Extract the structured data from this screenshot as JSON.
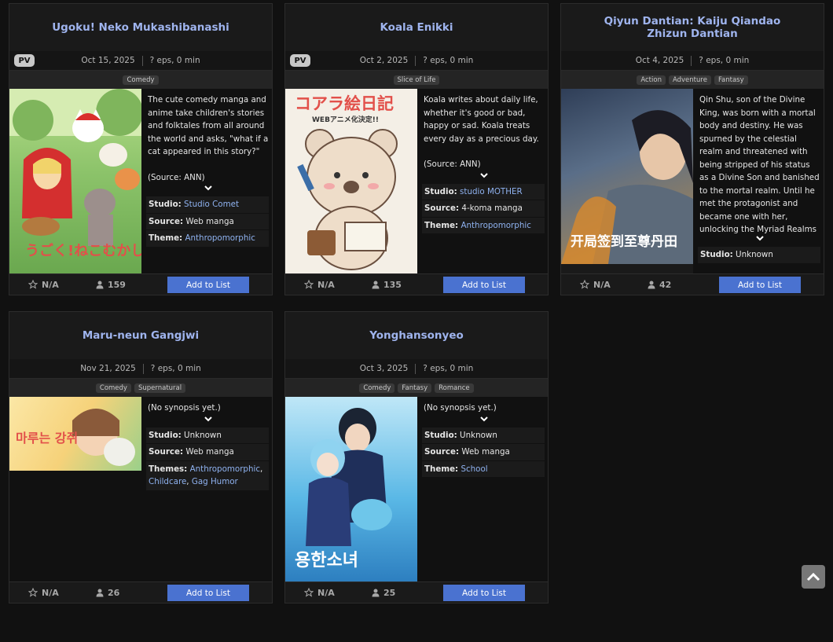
{
  "cards": [
    {
      "title": "Ugoku! Neko Mukashibanashi",
      "pv": "PV",
      "date": "Oct 15, 2025",
      "eps": "? eps, 0 min",
      "genres": [
        "Comedy"
      ],
      "synopsis": "The cute comedy manga and anime take children's stories and folktales from all around the world and asks, \"what if a cat appeared in this story?\"",
      "source_note": "(Source: ANN)",
      "studio_label": "Studio:",
      "studio": "Studio Comet",
      "source_label": "Source:",
      "source": "Web manga",
      "theme_label": "Theme:",
      "themes": "Anthropomorphic",
      "score": "N/A",
      "members": "159",
      "add_label": "Add to List",
      "cover_text": "うごく!ねこむかしばなし",
      "cover_color": "#8cc36a"
    },
    {
      "title": "Koala Enikki",
      "pv": "PV",
      "date": "Oct 2, 2025",
      "eps": "? eps, 0 min",
      "genres": [
        "Slice of Life"
      ],
      "synopsis": "Koala writes about daily life, whether it's good or bad, happy or sad. Koala treats every day as a precious day.",
      "source_note": "(Source: ANN)",
      "studio_label": "Studio:",
      "studio": "studio MOTHER",
      "source_label": "Source:",
      "source": "4-koma manga",
      "theme_label": "Theme:",
      "themes": "Anthropomorphic",
      "score": "N/A",
      "members": "135",
      "add_label": "Add to List",
      "cover_text": "コアラ絵日記",
      "cover_sub": "WEBアニメ化決定!!",
      "cover_color": "#f4efe6"
    },
    {
      "title": "Qiyun Dantian: Kaiju Qiandao Zhizun Dantian",
      "date": "Oct 4, 2025",
      "eps": "? eps, 0 min",
      "genres": [
        "Action",
        "Adventure",
        "Fantasy"
      ],
      "synopsis": "Qin Shu, son of the Divine King, was born with a mortal body and destiny. He was spurned by the celestial realm and threatened with being stripped of his status as a Divine Son and banished to the mortal realm. Until he met the protagonist and became one with her, unlocking the Myriad Realms sign-in system and",
      "studio_label": "Studio:",
      "studio": "Unknown",
      "score": "N/A",
      "members": "42",
      "add_label": "Add to List",
      "cover_text": "开局签到至尊丹田",
      "cover_color": "#5a6e88"
    },
    {
      "title": "Maru-neun Gangjwi",
      "date": "Nov 21, 2025",
      "eps": "? eps, 0 min",
      "genres": [
        "Comedy",
        "Supernatural"
      ],
      "synopsis": "(No synopsis yet.)",
      "studio_label": "Studio:",
      "studio": "Unknown",
      "source_label": "Source:",
      "source": "Web manga",
      "theme_label": "Themes:",
      "themes_list": [
        "Anthropomorphic",
        "Childcare",
        "Gag Humor"
      ],
      "score": "N/A",
      "members": "26",
      "add_label": "Add to List",
      "cover_text": "마루는 강쥐",
      "cover_color": "#f6d27a"
    },
    {
      "title": "Yonghansonyeo",
      "date": "Oct 3, 2025",
      "eps": "? eps, 0 min",
      "genres": [
        "Comedy",
        "Fantasy",
        "Romance"
      ],
      "synopsis": "(No synopsis yet.)",
      "studio_label": "Studio:",
      "studio": "Unknown",
      "source_label": "Source:",
      "source": "Web manga",
      "theme_label": "Theme:",
      "themes": "School",
      "score": "N/A",
      "members": "25",
      "add_label": "Add to List",
      "cover_text": "용한소녀",
      "cover_color": "#5ab8e6"
    }
  ]
}
